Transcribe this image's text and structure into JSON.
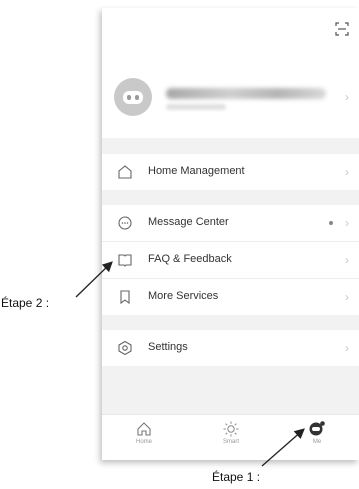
{
  "profile": {
    "name": "Tap to Set Nickname",
    "subtitle": ""
  },
  "menu_sections": [
    {
      "items": [
        {
          "label": "Home Management",
          "icon": "house-outline-icon"
        }
      ]
    },
    {
      "items": [
        {
          "label": "Message Center",
          "icon": "chat-bubble-icon",
          "has_dot": true
        },
        {
          "label": "FAQ & Feedback",
          "icon": "book-icon"
        },
        {
          "label": "More Services",
          "icon": "bookmark-icon"
        }
      ]
    },
    {
      "items": [
        {
          "label": "Settings",
          "icon": "gear-hexagon-icon"
        }
      ]
    }
  ],
  "tabs": [
    {
      "label": "Home",
      "icon": "home-icon",
      "active": false
    },
    {
      "label": "Smart",
      "icon": "sun-icon",
      "active": false
    },
    {
      "label": "Me",
      "icon": "me-icon",
      "active": true
    }
  ],
  "annotations": {
    "step1": "Étape 1 :",
    "step2": "Étape 2 :"
  },
  "colors": {
    "active_tab": "#333333",
    "inactive": "#999999",
    "background": "#f2f2f2"
  }
}
